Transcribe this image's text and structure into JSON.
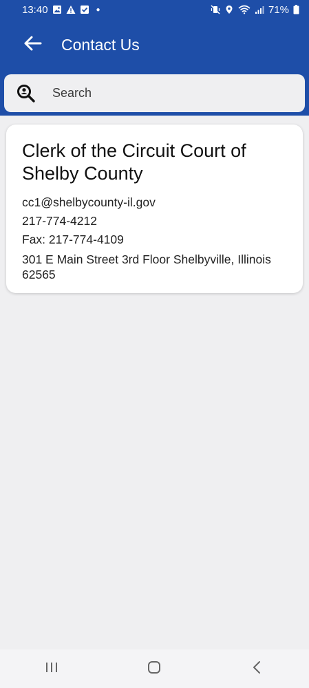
{
  "status_bar": {
    "time": "13:40",
    "battery": "71%",
    "left_icons": [
      "image-icon",
      "warning-icon",
      "checkbox-icon",
      "dot"
    ],
    "right_icons": [
      "mute-vibrate-icon",
      "location-icon",
      "wifi-icon",
      "signal-icon",
      "battery-icon"
    ]
  },
  "app_bar": {
    "title": "Contact Us",
    "back_icon": "arrow-left-icon",
    "background": "#1e4ea8"
  },
  "search": {
    "placeholder": "Search",
    "icon": "search-person-icon"
  },
  "contacts": [
    {
      "name": " Clerk of the Circuit Court of Shelby County",
      "email": "cc1@shelbycounty-il.gov",
      "phone": "217-774-4212",
      "fax": "Fax:  217-774-4109",
      "address": "301 E Main Street 3rd Floor Shelbyville, Illinois 62565"
    }
  ],
  "nav_bar": {
    "icons": [
      "recent-apps-icon",
      "home-icon",
      "back-icon"
    ]
  }
}
